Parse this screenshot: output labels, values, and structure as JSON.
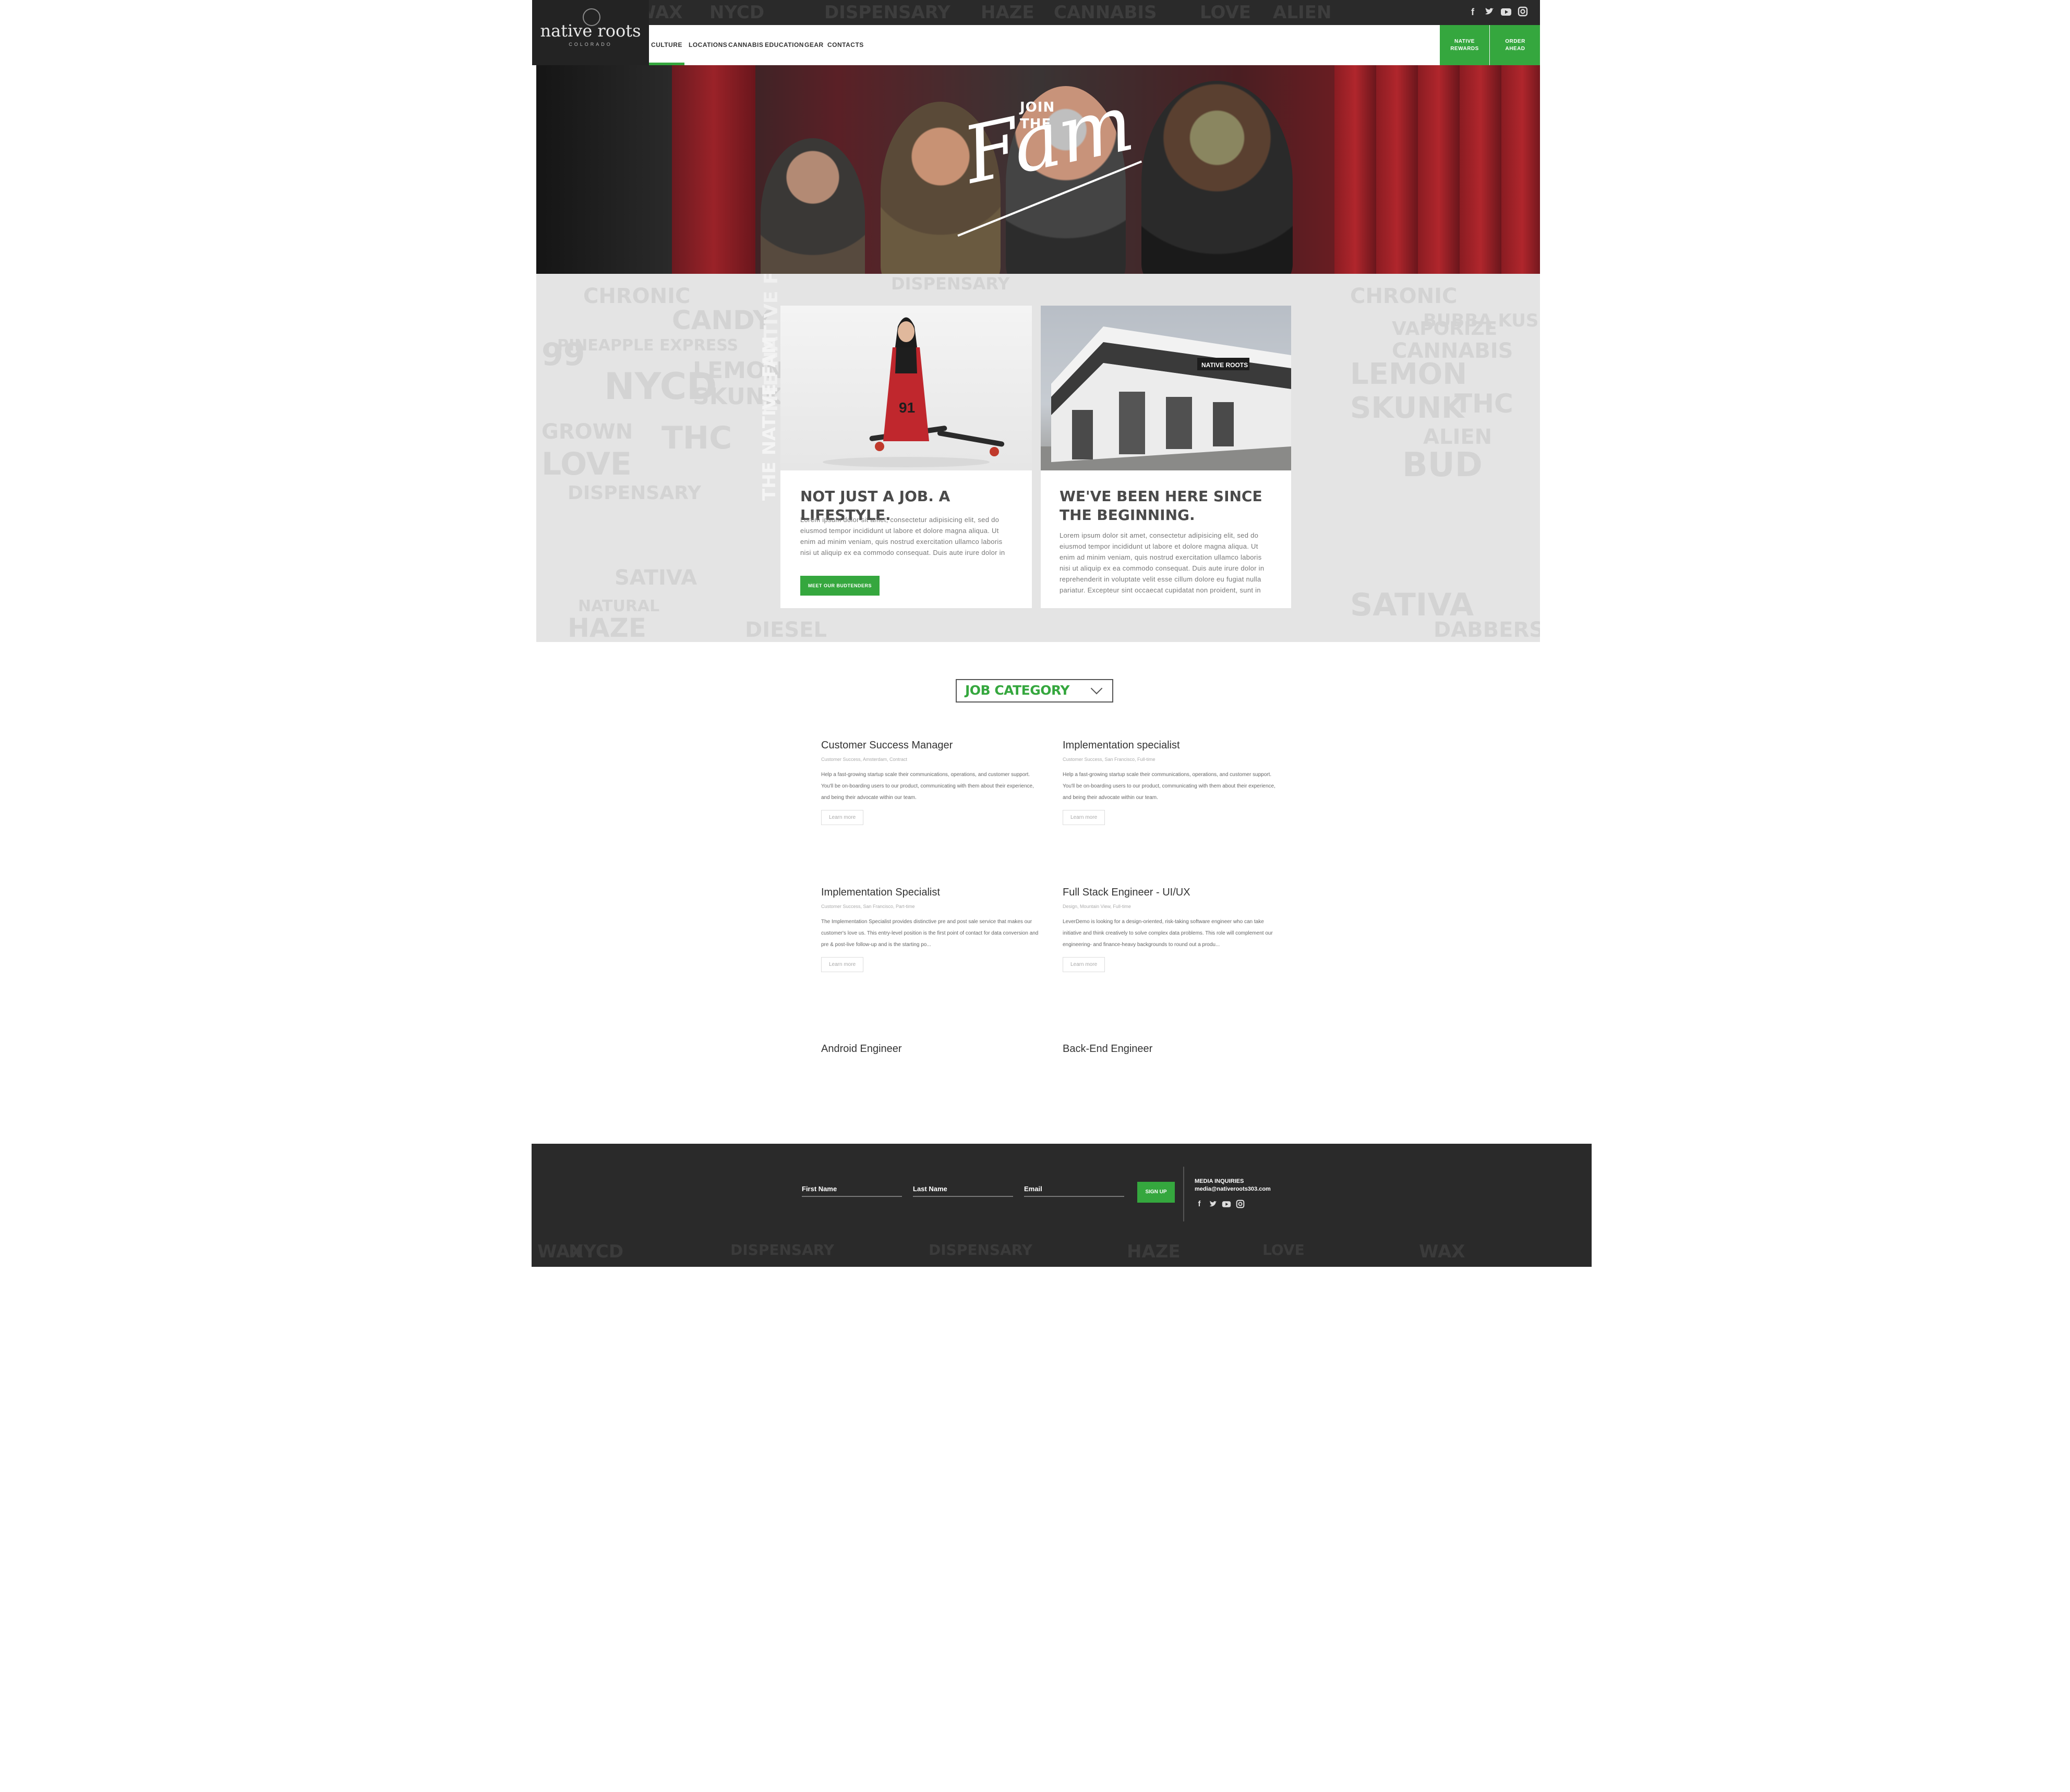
{
  "brand": {
    "logo_text": "native roots",
    "logo_sub": "COLORADO",
    "accent": "#35a73e",
    "dark": "#2a2a2a"
  },
  "social_top": [
    "facebook-icon",
    "twitter-icon",
    "youtube-icon",
    "instagram-icon"
  ],
  "nav": {
    "items": [
      "CULTURE",
      "LOCATIONS",
      "CANNABIS",
      "EDUCATION",
      "GEAR",
      "CONTACTS"
    ],
    "active": "CULTURE",
    "rewards_label": "NATIVE REWARDS",
    "order_label": "ORDER AHEAD"
  },
  "hero": {
    "join": "JOIN",
    "the": "THE",
    "fam": "Fam"
  },
  "pattern_words": [
    "CHRONIC",
    "CANDY",
    "99",
    "DISPENSARY",
    "HAZE",
    "PINEAPPLE EXPRESS",
    "NYCD",
    "LEMON",
    "SKUNK",
    "THC",
    "GROWN",
    "LOVE",
    "SATIVA",
    "NATURAL",
    "BUBBA KUSH",
    "VAPORIZE",
    "CANNABIS",
    "ALIEN",
    "BUD",
    "WAX",
    "DABBERS",
    "DIESEL",
    "THE NATIVE FAM"
  ],
  "cards": [
    {
      "heading": "NOT JUST A JOB. A LIFESTYLE.",
      "body": "Lorem ipsum dolor sit amet, consectetur adipisicing elit, sed do eiusmod tempor incididunt ut labore et dolore magna aliqua. Ut enim ad minim veniam, quis nostrud exercitation ullamco laboris nisi ut aliquip ex ea commodo consequat. Duis aute irure dolor in",
      "button": "MEET OUR BUDTENDERS"
    },
    {
      "heading": "WE'VE BEEN HERE SINCE THE BEGINNING.",
      "body": "Lorem ipsum dolor sit amet, consectetur adipisicing elit, sed do eiusmod tempor incididunt ut labore et dolore magna aliqua. Ut enim ad minim veniam, quis nostrud exercitation ullamco laboris nisi ut aliquip ex ea commodo consequat. Duis aute irure dolor in reprehenderit in voluptate velit esse cillum dolore eu fugiat nulla pariatur. Excepteur sint occaecat cupidatat non proident, sunt in",
      "store_sign": "NATIVE ROOTS"
    }
  ],
  "job_category": "JOB CATEGORY",
  "jobs": [
    {
      "title": "Customer Success Manager",
      "meta": "Customer Success, Amsterdam, Contract",
      "desc": "Help a fast-growing startup scale their communications, operations, and customer support. You'll be on-boarding users to our product, communicating with them about their experience, and being their advocate within our team.",
      "button": "Learn more"
    },
    {
      "title": "Implementation specialist",
      "meta": "Customer Success, San Francisco, Full-time",
      "desc": "Help a fast-growing startup scale their communications, operations, and customer support. You'll be on-boarding users to our product, communicating with them about their experience, and being their advocate within our team.",
      "button": "Learn more"
    },
    {
      "title": "Implementation Specialist",
      "meta": "Customer Success, San Francisco, Part-time",
      "desc": "The Implementation Specialist provides distinctive pre and post sale service that makes our customer's love us. This entry-level position is the first point of contact for data conversion and pre & post-live follow-up and is the starting po...",
      "button": "Learn more"
    },
    {
      "title": "Full Stack Engineer - UI/UX",
      "meta": "Design, Mountain View, Full-time",
      "desc": "LeverDemo is looking for a design-oriented, risk-taking software engineer who can take initiative and think creatively to solve complex data problems. This role will complement our engineering- and finance-heavy backgrounds to round out a produ...",
      "button": "Learn more"
    },
    {
      "title": "Android Engineer"
    },
    {
      "title": "Back-End Engineer"
    }
  ],
  "footer": {
    "first_name": "First Name",
    "last_name": "Last Name",
    "email": "Email",
    "signup": "SIGN UP",
    "media_label": "MEDIA INQUIRIES",
    "media_email": "media@nativeroots303.com"
  }
}
